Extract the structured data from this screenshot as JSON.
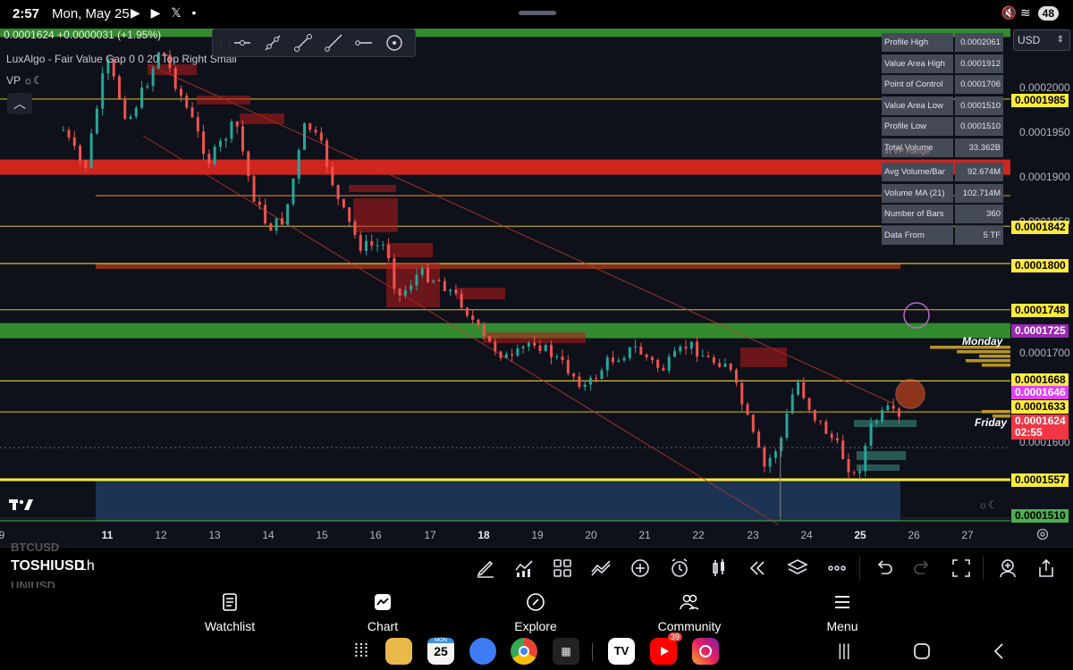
{
  "status_bar": {
    "time": "2:57",
    "date": "Mon, May 25",
    "notif_icons": "▶ ▶ 𝕏 •",
    "battery": "48"
  },
  "chart_legend": {
    "price": "0.0001624 +0.0000031 (+1.95%)",
    "indicator": "LuxAlgo - Fair Value Gap 0 0 20 Top Right Small",
    "vp": "VP ☼☾"
  },
  "currency": "USD",
  "stats": [
    {
      "label": "Profile High",
      "value": "0.0002061"
    },
    {
      "label": "Value Area High",
      "value": "0.0001912"
    },
    {
      "label": "Point of Control",
      "value": "0.0001706"
    },
    {
      "label": "Value Area Low",
      "value": "0.0001510"
    },
    {
      "label": "Profile Low",
      "value": "0.0001510"
    },
    {
      "label": "Total Volume",
      "value": "33.362B"
    },
    {
      "label": "Avg Volume/Bar",
      "value": "92.674M"
    },
    {
      "label": "Volume MA (21)",
      "value": "102.714M"
    },
    {
      "label": "Number of Bars",
      "value": "360"
    },
    {
      "label": "Data From",
      "value": "5 TF"
    }
  ],
  "in_vp_range": "In VP Range",
  "price_axis": {
    "grey_labels": [
      "0.0002000",
      "0.0001950",
      "0.0001900",
      "0.0001850",
      "0.0001700",
      "0.0001600"
    ],
    "tags": [
      {
        "text": "0.0001985",
        "bg": "#ffeb3b",
        "fg": "#000000"
      },
      {
        "text": "0.0001842",
        "bg": "#ffeb3b",
        "fg": "#000000"
      },
      {
        "text": "0.0001800",
        "bg": "#ffeb3b",
        "fg": "#000000"
      },
      {
        "text": "0.0001748",
        "bg": "#ffeb3b",
        "fg": "#000000"
      },
      {
        "text": "0.0001725",
        "bg": "#9c27b0",
        "fg": "#ffffff"
      },
      {
        "text": "0.0001668",
        "bg": "#ffeb3b",
        "fg": "#000000"
      },
      {
        "text": "0.0001646",
        "bg": "#e040fb",
        "fg": "#ffffff"
      },
      {
        "text": "0.0001633",
        "bg": "#ffeb3b",
        "fg": "#000000"
      },
      {
        "text": "0.0001624",
        "bg": "#f23645",
        "fg": "#ffffff"
      },
      {
        "text": "02:55",
        "bg": "#f23645",
        "fg": "#ffffff"
      },
      {
        "text": "0.0001557",
        "bg": "#ffeb3b",
        "fg": "#000000"
      },
      {
        "text": "0.0001510",
        "bg": "#4caf50",
        "fg": "#000000"
      }
    ]
  },
  "session_labels": {
    "monday": "Monday",
    "friday": "Friday"
  },
  "time_axis": [
    "9",
    "11",
    "12",
    "13",
    "14",
    "15",
    "16",
    "17",
    "18",
    "19",
    "20",
    "21",
    "22",
    "23",
    "24",
    "25",
    "26",
    "27"
  ],
  "toolbar": {
    "ghost_symbols": [
      "BTCUSD",
      "UNIUSD"
    ],
    "symbol": "TOSHIUSD",
    "interval": "1h"
  },
  "bottom_nav": [
    {
      "label": "Watchlist",
      "icon": "watchlist-icon"
    },
    {
      "label": "Chart",
      "icon": "chart-icon"
    },
    {
      "label": "Explore",
      "icon": "compass-icon"
    },
    {
      "label": "Community",
      "icon": "community-icon"
    },
    {
      "label": "Menu",
      "icon": "menu-icon"
    }
  ],
  "dock": {
    "calendar_day": "25",
    "calendar_month": "MON",
    "youtube_badge": "39"
  },
  "colors": {
    "bg": "#0e111a",
    "up": "#26a69a",
    "down": "#ef5350",
    "zone_green": "#3aa034",
    "zone_red": "#d0251f",
    "level_yellow": "#f0d43a",
    "value_area_blue": "#1f3a5f"
  },
  "chart_data": {
    "type": "candlestick",
    "symbol": "TOSHIUSD",
    "interval": "1h",
    "last_price": 0.0001624,
    "change": 3.1e-06,
    "change_pct": 1.95,
    "ylim": [
      0.00015,
      0.000208
    ],
    "x_ticks": [
      "9",
      "11",
      "12",
      "13",
      "14",
      "15",
      "16",
      "17",
      "18",
      "19",
      "20",
      "21",
      "22",
      "23",
      "24",
      "25",
      "26",
      "27"
    ],
    "price_path": [
      {
        "day": 10.2,
        "price": 0.000195
      },
      {
        "day": 10.6,
        "price": 0.0001905
      },
      {
        "day": 11.0,
        "price": 0.000203
      },
      {
        "day": 11.4,
        "price": 0.000196
      },
      {
        "day": 11.8,
        "price": 0.000201
      },
      {
        "day": 12.0,
        "price": 0.0002045
      },
      {
        "day": 12.3,
        "price": 0.0002
      },
      {
        "day": 12.6,
        "price": 0.000196
      },
      {
        "day": 12.9,
        "price": 0.0001915
      },
      {
        "day": 13.4,
        "price": 0.000196
      },
      {
        "day": 13.7,
        "price": 0.000188
      },
      {
        "day": 14.0,
        "price": 0.000184
      },
      {
        "day": 14.3,
        "price": 0.000185
      },
      {
        "day": 14.7,
        "price": 0.000196
      },
      {
        "day": 15.0,
        "price": 0.000193
      },
      {
        "day": 15.3,
        "price": 0.000187
      },
      {
        "day": 15.7,
        "price": 0.000182
      },
      {
        "day": 16.2,
        "price": 0.000182
      },
      {
        "day": 16.4,
        "price": 0.000176
      },
      {
        "day": 16.8,
        "price": 0.000179
      },
      {
        "day": 17.2,
        "price": 0.000178
      },
      {
        "day": 17.6,
        "price": 0.0001755
      },
      {
        "day": 18.0,
        "price": 0.0001715
      },
      {
        "day": 18.5,
        "price": 0.000169
      },
      {
        "day": 18.9,
        "price": 0.0001715
      },
      {
        "day": 19.4,
        "price": 0.000169
      },
      {
        "day": 19.9,
        "price": 0.000166
      },
      {
        "day": 20.3,
        "price": 0.000169
      },
      {
        "day": 20.8,
        "price": 0.0001705
      },
      {
        "day": 21.3,
        "price": 0.000168
      },
      {
        "day": 21.8,
        "price": 0.000171
      },
      {
        "day": 22.2,
        "price": 0.000169
      },
      {
        "day": 22.5,
        "price": 0.000169
      },
      {
        "day": 22.8,
        "price": 0.000164
      },
      {
        "day": 23.2,
        "price": 0.000157
      },
      {
        "day": 23.5,
        "price": 0.00016
      },
      {
        "day": 23.8,
        "price": 0.000167
      },
      {
        "day": 24.1,
        "price": 0.000163
      },
      {
        "day": 24.5,
        "price": 0.00016
      },
      {
        "day": 24.9,
        "price": 0.0001557
      },
      {
        "day": 25.2,
        "price": 0.000162
      },
      {
        "day": 25.5,
        "price": 0.0001635
      },
      {
        "day": 25.7,
        "price": 0.0001624
      }
    ],
    "zones": [
      {
        "kind": "supply",
        "top": 0.0002085,
        "bottom": 0.0002055
      },
      {
        "kind": "resistance",
        "top": 0.0001917,
        "bottom": 0.0001903
      },
      {
        "kind": "demand",
        "top": 0.0001733,
        "bottom": 0.000172
      },
      {
        "kind": "value_area",
        "top": 0.0001557,
        "bottom": 0.000151
      }
    ],
    "levels": [
      0.0001985,
      0.0001842,
      0.00018,
      0.0001748,
      0.0001668,
      0.0001633,
      0.0001557
    ]
  }
}
